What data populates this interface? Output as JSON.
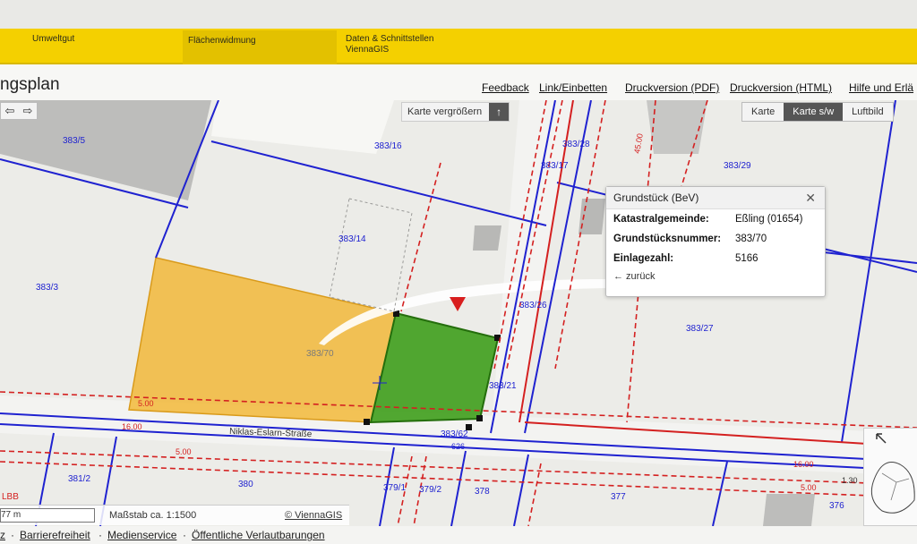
{
  "topnav": {
    "items": [
      {
        "label": "Umweltgut",
        "active": false
      },
      {
        "label": "Flächenwidmung",
        "active": true
      },
      {
        "label": "Daten & Schnittstellen",
        "sub": "ViennaGIS",
        "active": false
      }
    ]
  },
  "header": {
    "title": "ngsplan",
    "links": [
      "Feedback",
      "Link/Einbetten",
      "Druckversion (PDF)",
      "Druckversion (HTML)",
      "Hilfe und Erlä"
    ]
  },
  "map": {
    "nav_left": "⇦",
    "nav_right": "⇨",
    "enlarge_label": "Karte vergrößern",
    "enlarge_icon": "↑",
    "view_modes": [
      "Karte",
      "Karte s/w",
      "Luftbild"
    ],
    "active_view": "Karte s/w",
    "parcel_labels": [
      "383/5",
      "383/16",
      "383/28",
      "383/17",
      "383/29",
      "383/14",
      "383/3",
      "383/26",
      "383/27",
      "383/70",
      "383/21",
      "383/62",
      "381/2",
      "380",
      "379/1",
      "379/2",
      "378",
      "377",
      "376"
    ],
    "street_name": "Niklas-Eslarn-Straße",
    "house_number": "626",
    "measurements": [
      "45.00",
      "5.00",
      "16.00",
      "5.00",
      "16.00",
      "5.00",
      "1.30"
    ],
    "zone_label": "LBB",
    "colors": {
      "parcel_line": "#1f22d0",
      "building_line": "#d42020",
      "selected_parcel": "#3f9e1c",
      "highlight_area": "#f2b93a"
    }
  },
  "popup": {
    "title": "Grundstück (BeV)",
    "close_icon": "✕",
    "rows": [
      {
        "key": "Katastralgemeinde:",
        "value": "Eßling (01654)"
      },
      {
        "key": "Grundstücksnummer:",
        "value": "383/70"
      },
      {
        "key": "Einlagezahl:",
        "value": "5166"
      }
    ],
    "back_label": "← zurück"
  },
  "scalebar": {
    "scale_value": "77 m",
    "massstab": "Maßstab ca. 1:1500",
    "copyright": "© ViennaGIS"
  },
  "footer": {
    "links": [
      "z",
      "Barrierefreiheit",
      "Medienservice",
      "Öffentliche Verlautbarungen"
    ],
    "separator": "·"
  }
}
